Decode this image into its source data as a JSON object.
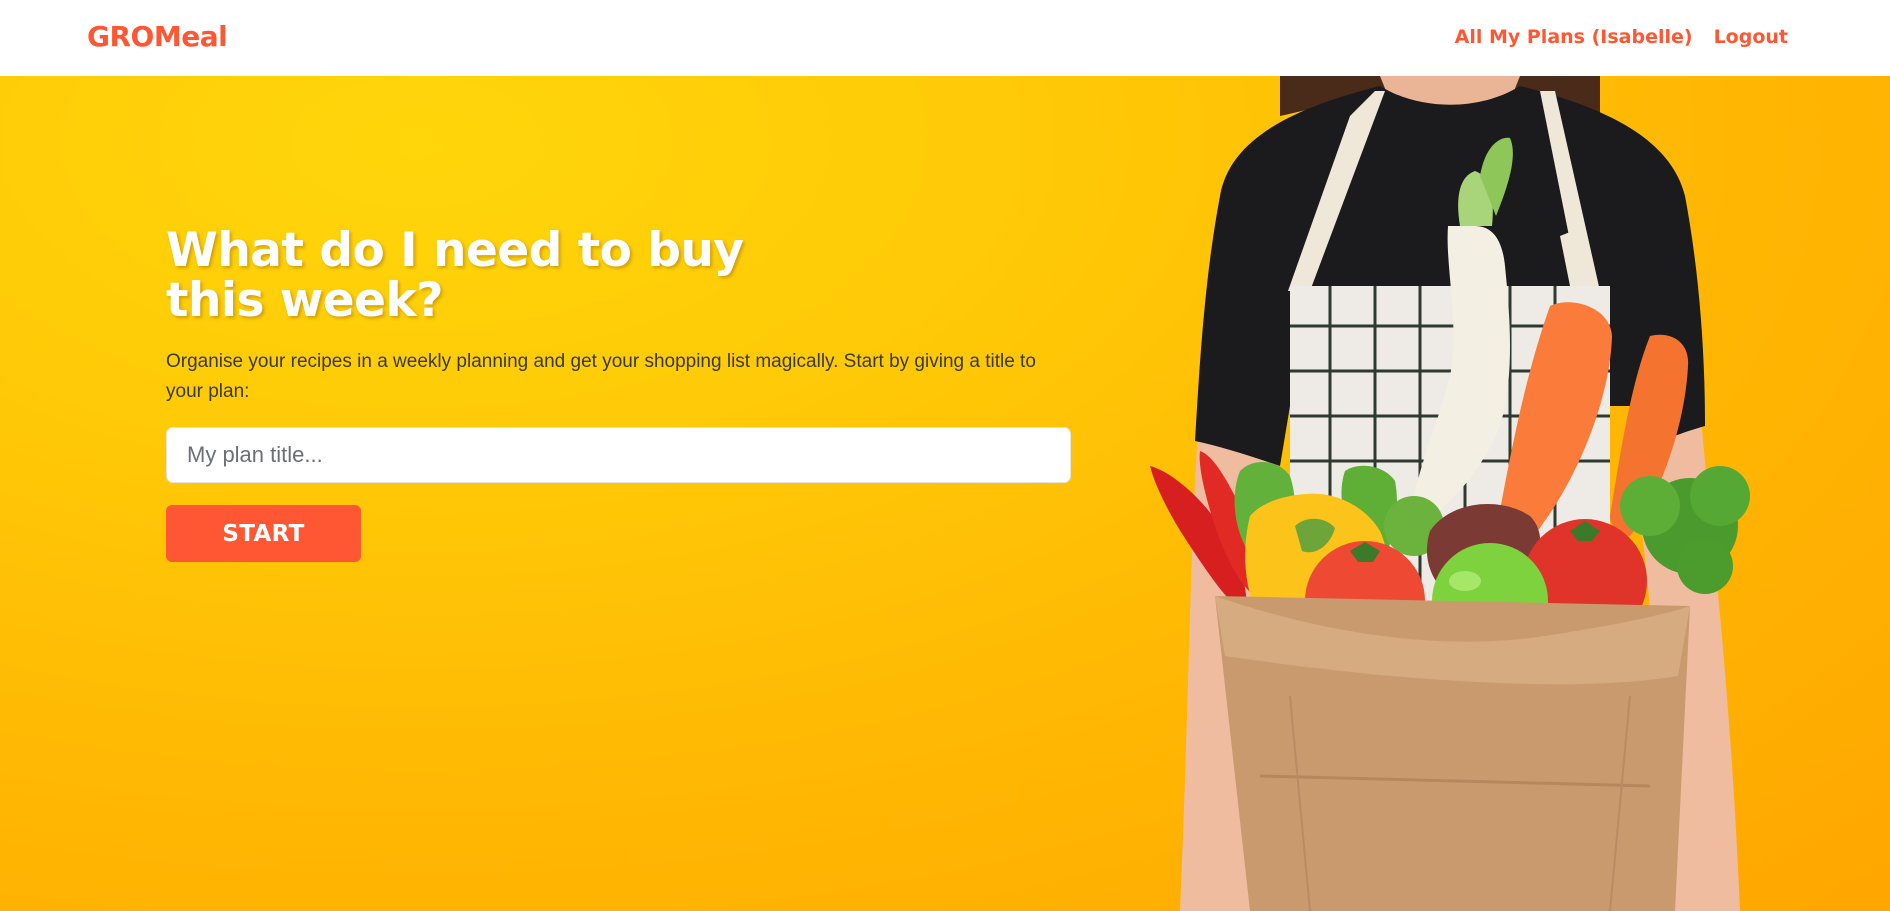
{
  "navbar": {
    "brand": "GROMeal",
    "links": [
      {
        "label": "All My Plans (Isabelle)"
      },
      {
        "label": "Logout"
      }
    ]
  },
  "hero": {
    "title": "What do I need to buy this week?",
    "subtitle": "Organise your recipes in a weekly planning and get your shopping list magically. Start by giving a title to your plan:",
    "input": {
      "placeholder": "My plan title...",
      "value": ""
    },
    "start_label": "START"
  },
  "colors": {
    "brand": "#ff5733",
    "hero_background": "#ffc107",
    "button": "#ff5733",
    "text_white": "#ffffff"
  },
  "image": {
    "description_icon": "woman-with-grocery-bag-photo"
  }
}
